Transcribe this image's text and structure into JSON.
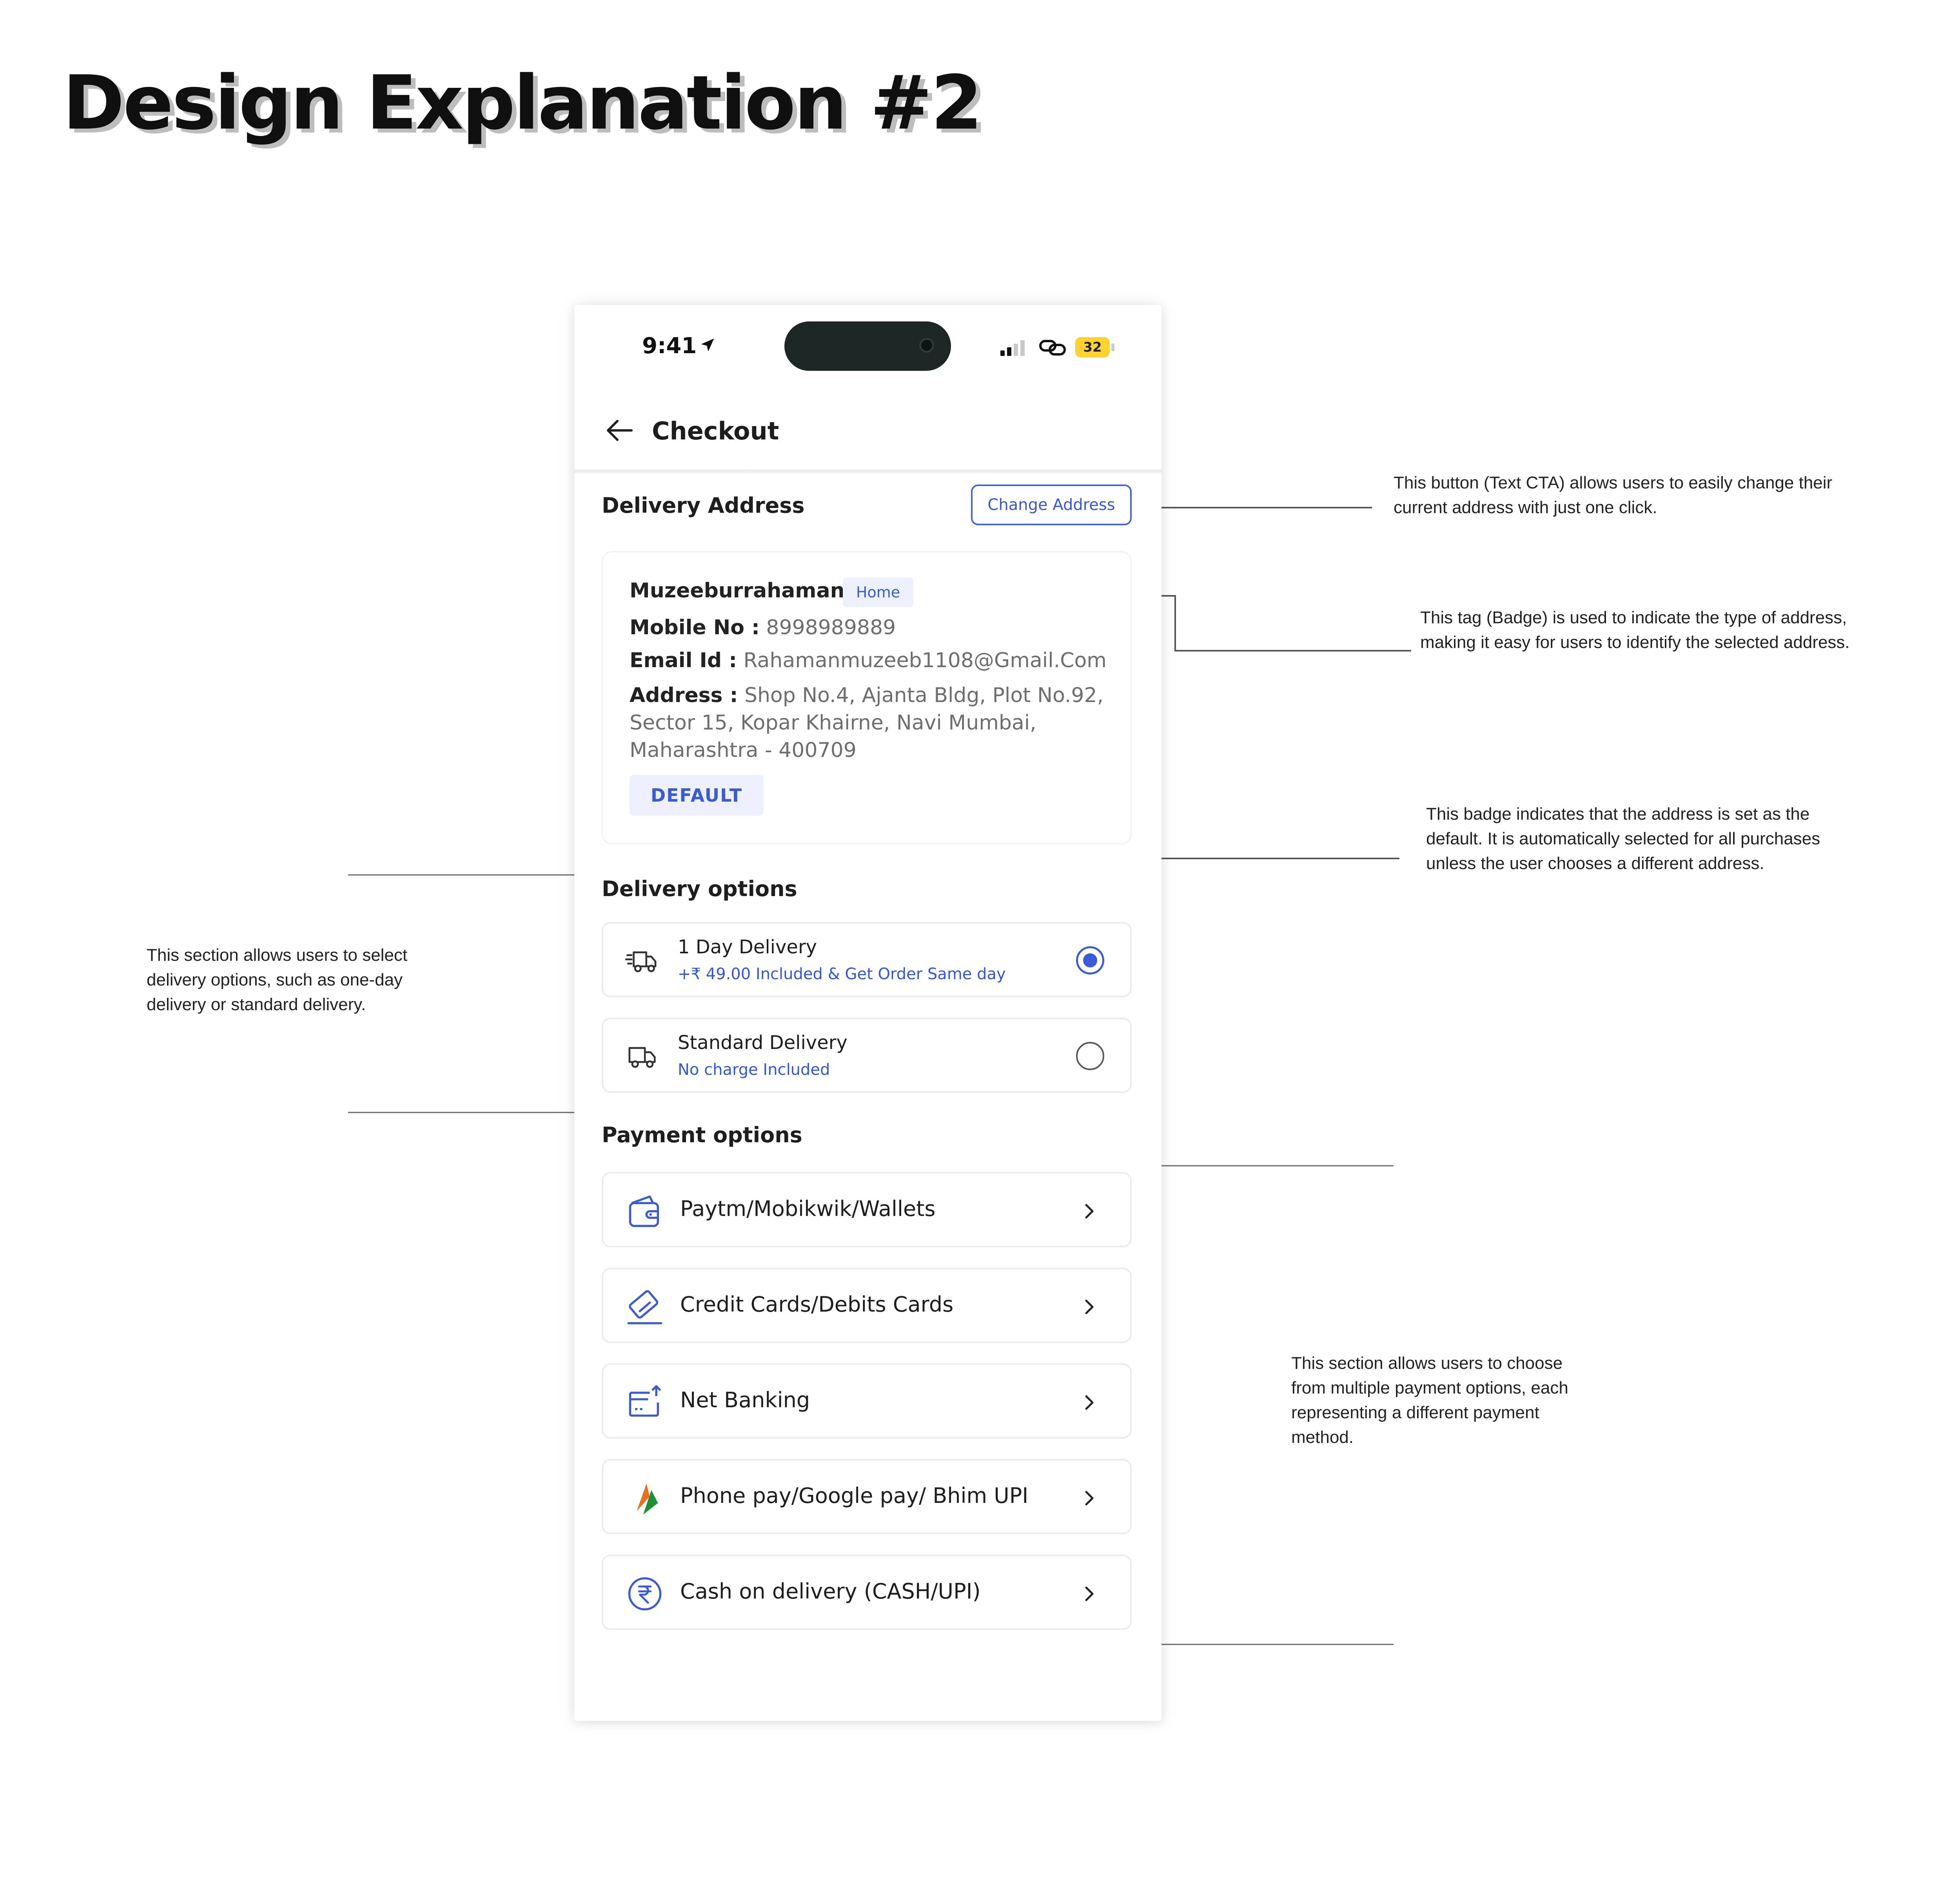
{
  "page": {
    "title": "Design Explanation #2"
  },
  "annotations": {
    "change_address": "This button (Text CTA) allows users to easily change their current address with just one click.",
    "home_tag": "This tag (Badge) is used to indicate the type of address, making it easy for users to identify the selected address.",
    "default_badge": "This badge indicates that the address is set as the default. It is automatically selected for all purchases unless the user chooses a different address.",
    "delivery_section": "This section allows users to select delivery options, such as one-day delivery or standard delivery.",
    "payment_section": "This section allows users to choose from multiple payment options, each representing a different payment method."
  },
  "status_bar": {
    "time": "9:41",
    "battery": "32",
    "battery_color": "#ffd232"
  },
  "header": {
    "title": "Checkout",
    "back_icon": "arrow-left-icon"
  },
  "delivery_address": {
    "section_title": "Delivery Address",
    "change_button": "Change Address",
    "name": "Muzeeburrahaman",
    "tag": "Home",
    "mobile_label": "Mobile No :",
    "mobile": "8998989889",
    "email_label": "Email Id :",
    "email": "Rahamanmuzeeb1108@Gmail.Com",
    "address_label": "Address :",
    "address": "Shop No.4, Ajanta Bldg, Plot No.92, Sector 15, Kopar Khairne, Navi Mumbai, Maharashtra - 400709",
    "default_badge": "DEFAULT"
  },
  "delivery_options": {
    "section_title": "Delivery options",
    "items": [
      {
        "title": "1 Day Delivery",
        "subtitle": "+₹ 49.00 Included & Get Order Same day",
        "selected": true,
        "icon": "fast-truck-icon"
      },
      {
        "title": "Standard Delivery",
        "subtitle": "No charge Included",
        "selected": false,
        "icon": "truck-icon"
      }
    ]
  },
  "payment_options": {
    "section_title": "Payment options",
    "items": [
      {
        "label": "Paytm/Mobikwik/Wallets",
        "icon": "wallet-icon"
      },
      {
        "label": "Credit Cards/Debits Cards",
        "icon": "card-icon"
      },
      {
        "label": "Net Banking",
        "icon": "bank-transfer-icon"
      },
      {
        "label": "Phone pay/Google pay/ Bhim UPI",
        "icon": "upi-icon"
      },
      {
        "label": "Cash on delivery (CASH/UPI)",
        "icon": "rupee-icon"
      }
    ]
  },
  "colors": {
    "accent": "#3b5bd6",
    "badge_bg": "#edf1fd"
  }
}
